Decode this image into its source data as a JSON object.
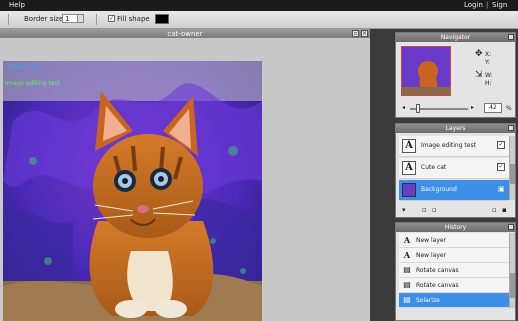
{
  "menubar": {
    "help": "Help",
    "login": "Login",
    "separator": "|",
    "signup": "Sign up"
  },
  "toolbar": {
    "border_size_label": "Border size:",
    "border_size_value": "1",
    "fill_shape_label": "Fill shape",
    "fill_shape_checked": "✓",
    "fill_color": "#000000"
  },
  "canvas_window": {
    "title": "cat-owner",
    "caption_1": "Cute cat",
    "caption_2": "Image editing test"
  },
  "navigator": {
    "title": "Navigator",
    "x_label": "X:",
    "y_label": "Y:",
    "w_label": "W:",
    "h_label": "H:",
    "zoom_value": "42",
    "zoom_unit": "%"
  },
  "layers": {
    "title": "Layers",
    "items": [
      {
        "label": "Image editing test",
        "checked": "✓"
      },
      {
        "label": "Cute cat",
        "checked": "✓"
      },
      {
        "label": "Background",
        "checked": ""
      }
    ]
  },
  "history": {
    "title": "History",
    "items": [
      {
        "label": "New layer",
        "icon": "A"
      },
      {
        "label": "New layer",
        "icon": "A"
      },
      {
        "label": "Rotate canvas",
        "icon": "▤"
      },
      {
        "label": "Rotate canvas",
        "icon": "▤"
      },
      {
        "label": "Solarize",
        "icon": "▤"
      }
    ]
  },
  "colors": {
    "accent": "#3d8ee6",
    "caption_1": "#39a9ff",
    "caption_2": "#66ee55"
  }
}
